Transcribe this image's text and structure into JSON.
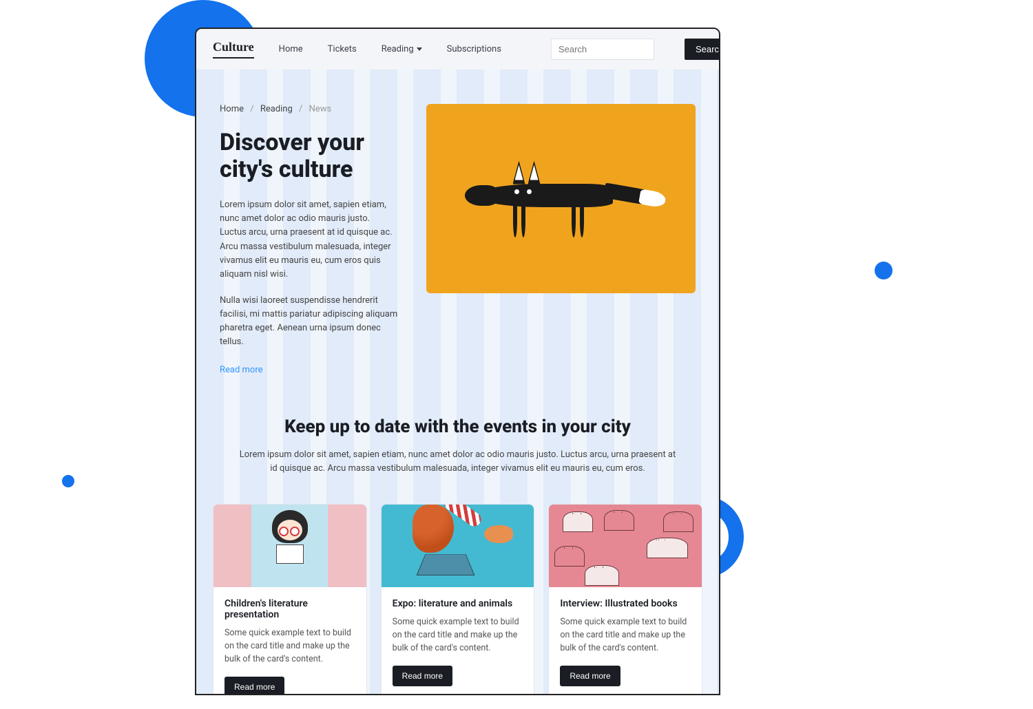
{
  "brand": "Culture",
  "nav": {
    "home": "Home",
    "tickets": "Tickets",
    "reading": "Reading",
    "subscriptions": "Subscriptions"
  },
  "search": {
    "placeholder": "Search",
    "button": "Search"
  },
  "breadcrumb": {
    "home": "Home",
    "reading": "Reading",
    "news": "News",
    "sep": "/"
  },
  "hero": {
    "title": "Discover your city's culture",
    "p1": "Lorem ipsum dolor sit amet, sapien etiam, nunc amet dolor ac odio mauris justo. Luctus arcu, urna praesent at id quisque ac. Arcu massa vestibulum malesuada, integer vivamus elit eu mauris eu, cum eros quis aliquam nisl wisi.",
    "p2": "Nulla wisi laoreet suspendisse hendrerit facilisi, mi mattis pariatur adipiscing aliquam pharetra eget. Aenean urna ipsum donec tellus.",
    "read_more": "Read more"
  },
  "events": {
    "title": "Keep up to date with the events in your city",
    "sub": "Lorem ipsum dolor sit amet, sapien etiam, nunc amet dolor ac odio mauris justo. Luctus arcu, urna praesent at id quisque ac. Arcu massa vestibulum malesuada, integer vivamus elit eu mauris eu, cum eros."
  },
  "cards": [
    {
      "title": "Children's literature presentation",
      "text": "Some quick example text to build on the card title and make up the bulk of the card's content.",
      "btn": "Read more"
    },
    {
      "title": "Expo: literature and animals",
      "text": "Some quick example text to build on the card title and make up the bulk of the card's content.",
      "btn": "Read more"
    },
    {
      "title": "Interview: Illustrated books",
      "text": "Some quick example text to build on the card title and make up the bulk of the card's content.",
      "btn": "Read more"
    }
  ]
}
